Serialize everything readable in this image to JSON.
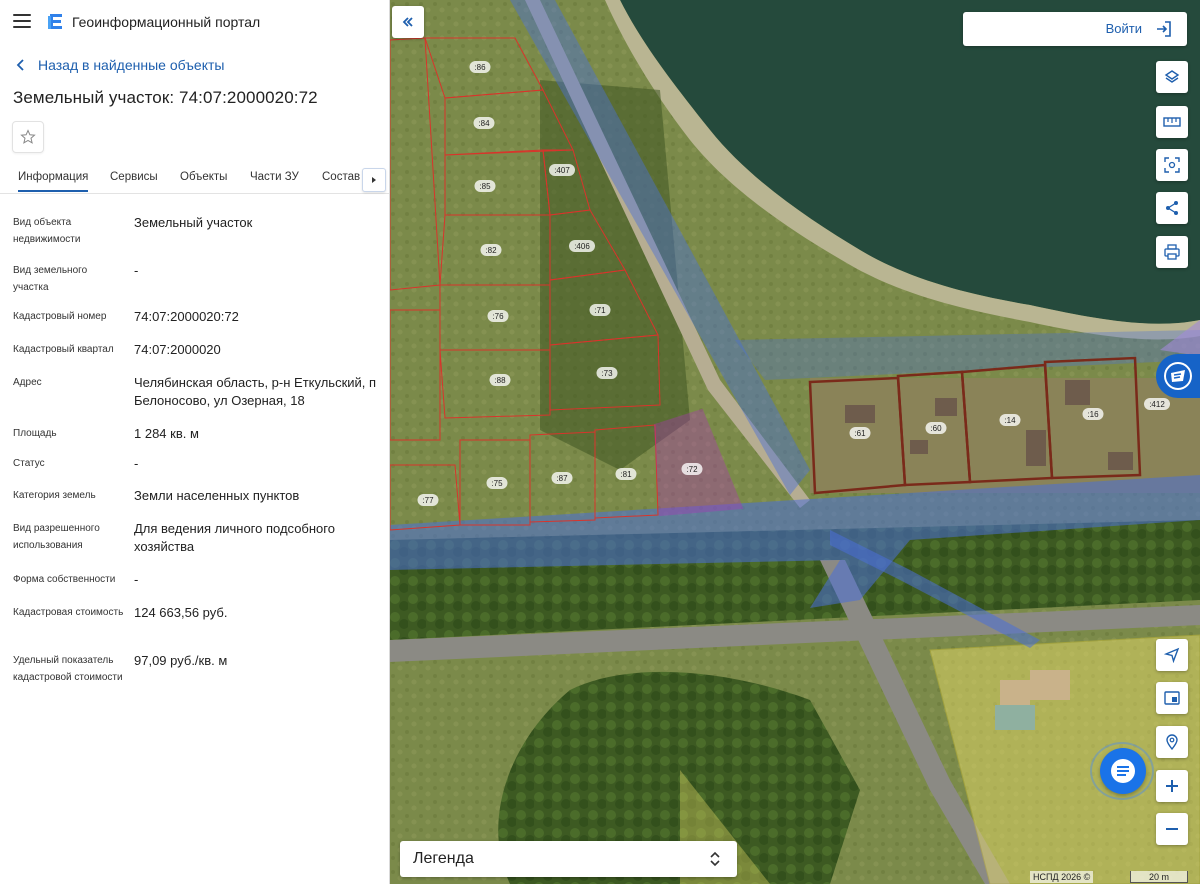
{
  "header": {
    "app_title": "Геоинформационный портал",
    "back_link": "Назад в найденные объекты",
    "page_title": "Земельный участок: 74:07:2000020:72"
  },
  "tabs": [
    {
      "label": "Информация",
      "active": true
    },
    {
      "label": "Сервисы",
      "active": false
    },
    {
      "label": "Объекты",
      "active": false
    },
    {
      "label": "Части ЗУ",
      "active": false
    },
    {
      "label": "Состав",
      "active": false
    }
  ],
  "properties": [
    {
      "key": "Вид объекта недвижимости",
      "value": "Земельный участок"
    },
    {
      "key": "Вид земельного участка",
      "value": "-"
    },
    {
      "key": "Кадастровый номер",
      "value": "74:07:2000020:72"
    },
    {
      "key": "Кадастровый квартал",
      "value": "74:07:2000020"
    },
    {
      "key": "Адрес",
      "value": "Челябинская область, р-н Еткульский, п Белоносово, ул Озерная, 18"
    },
    {
      "key": "Площадь",
      "value": "1 284 кв. м"
    },
    {
      "key": "Статус",
      "value": "-"
    },
    {
      "key": "Категория земель",
      "value": "Земли населенных пунктов"
    },
    {
      "key": "Вид разрешенного использования",
      "value": "Для ведения личного подсобного хозяйства"
    },
    {
      "key": "Форма собственности",
      "value": "-"
    },
    {
      "key": "Кадастровая стоимость",
      "value": "124 663,56 руб."
    },
    {
      "key": "Удельный показатель кадастровой стоимости",
      "value": "97,09 руб./кв. м"
    }
  ],
  "map": {
    "login_label": "Войти",
    "legend_label": "Легенда",
    "attribution": "НСПД 2026 ©",
    "scale_label": "20 m",
    "parcel_labels": [
      ":86",
      ":84",
      ":85",
      ":407",
      ":82",
      ":406",
      ":76",
      ":71",
      ":88",
      ":73",
      ":75",
      ":87",
      ":81",
      ":72",
      ":77",
      ":61",
      ":60",
      ":14",
      ":16",
      ":412"
    ],
    "colors": {
      "accent": "#1e5fae",
      "selected_parcel": "#b02fbe",
      "parcel_border": "#d9342b",
      "zone_overlay": "#4a6fd8",
      "yellow_zone": "#f0e36a"
    },
    "tools": [
      "layers-icon",
      "ruler-icon",
      "select-area-icon",
      "share-icon",
      "print-icon",
      "locate-icon",
      "minimap-icon",
      "search-location-icon",
      "zoom-in-icon",
      "zoom-out-icon"
    ]
  }
}
